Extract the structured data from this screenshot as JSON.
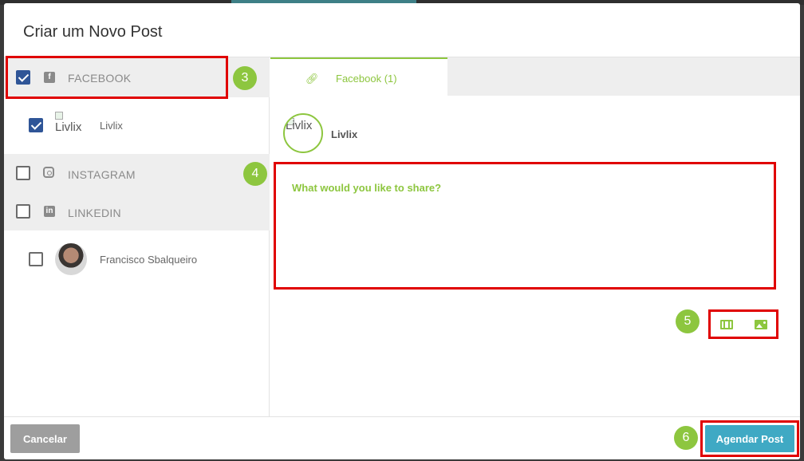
{
  "modal": {
    "title": "Criar um Novo Post"
  },
  "networks": [
    {
      "name": "FACEBOOK",
      "checked": true,
      "accounts": [
        {
          "name": "Livlix",
          "avatar_alt": "Livlix",
          "checked": true
        }
      ]
    },
    {
      "name": "INSTAGRAM",
      "checked": false,
      "accounts": []
    },
    {
      "name": "LINKEDIN",
      "checked": false,
      "accounts": [
        {
          "name": "Francisco Sbalqueiro",
          "checked": false
        }
      ]
    }
  ],
  "composer": {
    "tab_label": "Facebook (1)",
    "page_name": "Livlix",
    "page_avatar_alt": "Livlix",
    "placeholder": "What would you like to share?"
  },
  "footer": {
    "cancel_label": "Cancelar",
    "schedule_label": "Agendar Post"
  },
  "callouts": [
    "3",
    "4",
    "5",
    "6"
  ],
  "colors": {
    "accent_green": "#8dc63f",
    "schedule_blue": "#3fa9c4",
    "highlight_red": "#e00000",
    "checkbox_blue": "#2f5597"
  }
}
